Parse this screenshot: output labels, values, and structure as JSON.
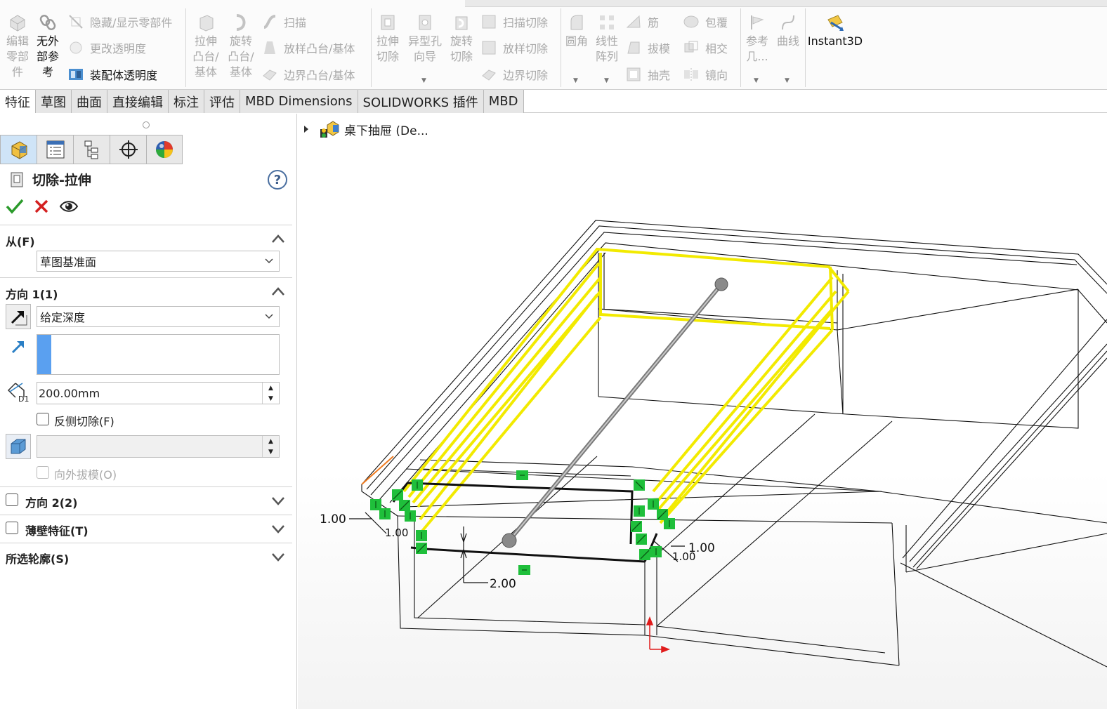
{
  "ribbon": {
    "edit_part": "编辑\n零部\n件",
    "no_external": "无外\n部参\n考",
    "hide_show": "隐藏/显示零部件",
    "change_transparency": "更改透明度",
    "assembly_transparency": "装配体透明度",
    "extrude_boss": "拉伸\n凸台/\n基体",
    "revolve_boss": "旋转\n凸台/\n基体",
    "sweep": "扫描",
    "loft_boss": "放样凸台/基体",
    "boundary_boss": "边界凸台/基体",
    "extrude_cut": "拉伸\n切除",
    "hole_wizard": "异型孔\n向导",
    "revolve_cut": "旋转\n切除",
    "sweep_cut": "扫描切除",
    "loft_cut": "放样切除",
    "boundary_cut": "边界切除",
    "fillet": "圆角",
    "linear_pattern": "线性\n阵列",
    "rib": "筋",
    "wrap": "包覆",
    "draft": "拔模",
    "intersect": "相交",
    "shell": "抽壳",
    "mirror": "镜向",
    "reference_geometry": "参考\n几...",
    "curves": "曲线",
    "instant3d": "Instant3D"
  },
  "tabs": [
    {
      "label": "特征",
      "active": true
    },
    {
      "label": "草图",
      "active": false
    },
    {
      "label": "曲面",
      "active": false
    },
    {
      "label": "直接编辑",
      "active": false
    },
    {
      "label": "标注",
      "active": false
    },
    {
      "label": "评估",
      "active": false
    },
    {
      "label": "MBD Dimensions",
      "active": false
    },
    {
      "label": "SOLIDWORKS 插件",
      "active": false
    },
    {
      "label": "MBD",
      "active": false
    }
  ],
  "pm": {
    "title": "切除-拉伸",
    "help": "?",
    "from": {
      "header": "从(F)",
      "value": "草图基准面"
    },
    "dir1": {
      "header": "方向 1(1)",
      "end_condition": "给定深度",
      "depth": "200.00mm",
      "depth_icon_label": "D1",
      "flip_side_cut": "反侧切除(F)",
      "draft_value": "",
      "draft_outward": "向外拔模(O)"
    },
    "dir2": "方向 2(2)",
    "thin": "薄壁特征(T)",
    "contours": "所选轮廓(S)"
  },
  "tree": {
    "assembly_name": "桌下抽屉 (De..."
  },
  "dims": {
    "d1": "1.00",
    "d2": "1.00",
    "d3": "2.00",
    "d4": "1.00",
    "d5": "1.00"
  },
  "colors": {
    "sketch_yellow": "#f2ea00",
    "constraint_green": "#1fbf3b",
    "ok_green": "#2a9a2a",
    "cancel_red": "#d42020",
    "accent_blue": "#5aa0f0"
  }
}
